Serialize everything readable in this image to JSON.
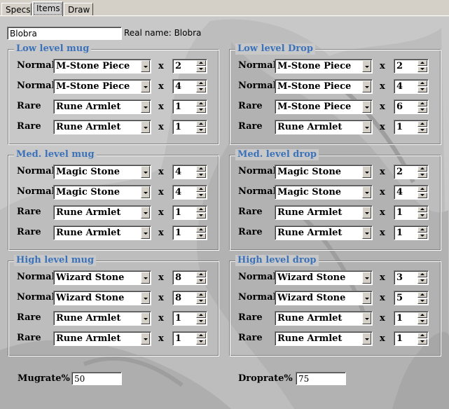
{
  "tabs": [
    {
      "label": "Specs"
    },
    {
      "label": "Items"
    },
    {
      "label": "Draw"
    }
  ],
  "monster": {
    "name": "Blobra",
    "real_name_text": "Real name: Blobra"
  },
  "groups": [
    {
      "title": "Low level mug",
      "items": [
        {
          "rarity": "Normal",
          "item": "M-Stone Piece",
          "qty": "2"
        },
        {
          "rarity": "Normal",
          "item": "M-Stone Piece",
          "qty": "4"
        },
        {
          "rarity": "Rare",
          "item": "Rune Armlet",
          "qty": "1"
        },
        {
          "rarity": "Rare",
          "item": "Rune Armlet",
          "qty": "1"
        }
      ]
    },
    {
      "title": "Low level Drop",
      "items": [
        {
          "rarity": "Normal",
          "item": "M-Stone Piece",
          "qty": "2"
        },
        {
          "rarity": "Normal",
          "item": "M-Stone Piece",
          "qty": "4"
        },
        {
          "rarity": "Rare",
          "item": "M-Stone Piece",
          "qty": "6"
        },
        {
          "rarity": "Rare",
          "item": "Rune Armlet",
          "qty": "1"
        }
      ]
    },
    {
      "title": "Med. level mug",
      "items": [
        {
          "rarity": "Normal",
          "item": "Magic Stone",
          "qty": "4"
        },
        {
          "rarity": "Normal",
          "item": "Magic Stone",
          "qty": "4"
        },
        {
          "rarity": "Rare",
          "item": "Rune Armlet",
          "qty": "1"
        },
        {
          "rarity": "Rare",
          "item": "Rune Armlet",
          "qty": "1"
        }
      ]
    },
    {
      "title": "Med. level drop",
      "items": [
        {
          "rarity": "Normal",
          "item": "Magic Stone",
          "qty": "2"
        },
        {
          "rarity": "Normal",
          "item": "Magic Stone",
          "qty": "4"
        },
        {
          "rarity": "Rare",
          "item": "Rune Armlet",
          "qty": "1"
        },
        {
          "rarity": "Rare",
          "item": "Rune Armlet",
          "qty": "1"
        }
      ]
    },
    {
      "title": "High level mug",
      "items": [
        {
          "rarity": "Normal",
          "item": "Wizard Stone",
          "qty": "8"
        },
        {
          "rarity": "Normal",
          "item": "Wizard Stone",
          "qty": "8"
        },
        {
          "rarity": "Rare",
          "item": "Rune Armlet",
          "qty": "1"
        },
        {
          "rarity": "Rare",
          "item": "Rune Armlet",
          "qty": "1"
        }
      ]
    },
    {
      "title": "High level drop",
      "items": [
        {
          "rarity": "Normal",
          "item": "Wizard Stone",
          "qty": "3"
        },
        {
          "rarity": "Normal",
          "item": "Wizard Stone",
          "qty": "5"
        },
        {
          "rarity": "Rare",
          "item": "Rune Armlet",
          "qty": "1"
        },
        {
          "rarity": "Rare",
          "item": "Rune Armlet",
          "qty": "1"
        }
      ]
    }
  ],
  "x_symbol": "x",
  "rates": {
    "mug_label": "Mugrate%",
    "mug_value": "50",
    "drop_label": "Droprate%",
    "drop_value": "75"
  },
  "colors": {
    "group_title": "#3b72b9",
    "background": "#c8c8c8"
  }
}
